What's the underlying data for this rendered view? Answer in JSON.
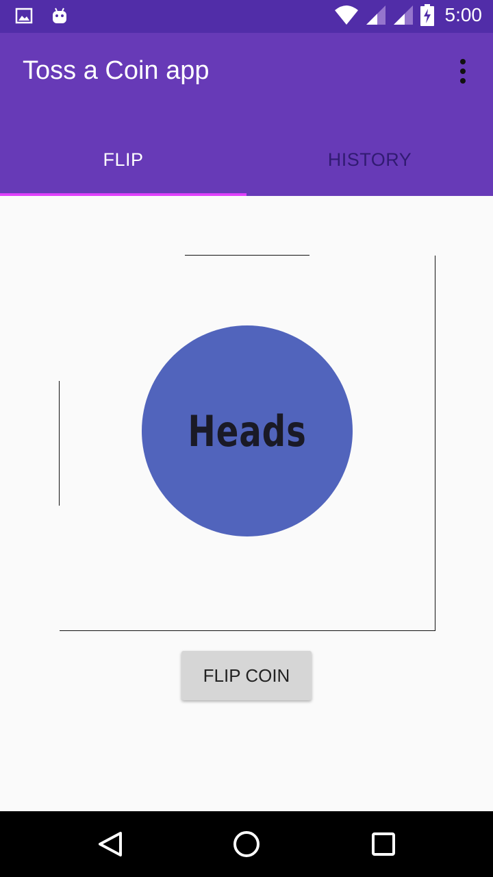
{
  "status_bar": {
    "time": "5:00",
    "icons": [
      "image-icon",
      "android-icon",
      "wifi-icon",
      "signal-icon",
      "signal-icon",
      "battery-charging-icon"
    ]
  },
  "app_bar": {
    "title": "Toss a Coin app",
    "menu_icon": "more-vert-icon"
  },
  "tabs": [
    {
      "label": "FLIP",
      "selected": true
    },
    {
      "label": "HISTORY",
      "selected": false
    }
  ],
  "coin": {
    "label": "Heads",
    "color": "#5164bc"
  },
  "flip_button": {
    "label": "FLIP COIN"
  },
  "nav_bar": {
    "icons": [
      "back-icon",
      "home-icon",
      "recents-icon"
    ]
  },
  "colors": {
    "status_bar": "#512da8",
    "app_bar": "#673ab7",
    "tab_indicator": "#e040fb",
    "background": "#fafafa"
  }
}
